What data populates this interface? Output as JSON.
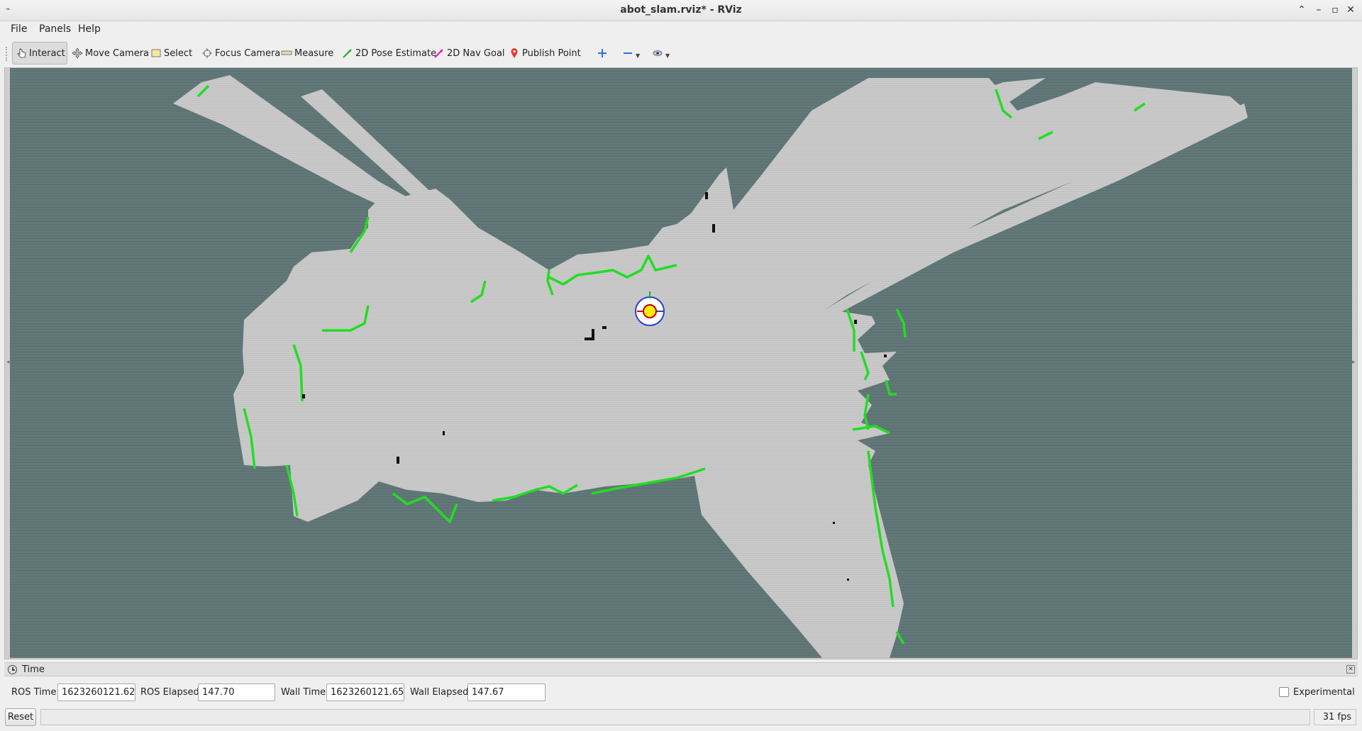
{
  "window": {
    "title": "abot_slam.rviz* - RViz",
    "app_icon": "rviz-icon",
    "controls": [
      "chevron-up-icon",
      "minimize-icon",
      "maximize-icon",
      "close-icon"
    ]
  },
  "menu": {
    "file": "File",
    "panels": "Panels",
    "help": "Help"
  },
  "toolbar": {
    "interact": "Interact",
    "move_camera": "Move Camera",
    "select": "Select",
    "focus_camera": "Focus Camera",
    "measure": "Measure",
    "pose_estimate": "2D Pose Estimate",
    "nav_goal": "2D Nav Goal",
    "publish_point": "Publish Point"
  },
  "viewport": {
    "background": "#627878",
    "free_space": "#c9c9c9",
    "laser_points": "#22dd22",
    "occupied": "#111111"
  },
  "time_panel": {
    "title": "Time",
    "ros_time_label": "ROS Time:",
    "ros_time": "1623260121.62",
    "ros_elapsed_label": "ROS Elapsed:",
    "ros_elapsed": "147.70",
    "wall_time_label": "Wall Time:",
    "wall_time": "1623260121.65",
    "wall_elapsed_label": "Wall Elapsed:",
    "wall_elapsed": "147.67",
    "experimental_label": "Experimental"
  },
  "bottom": {
    "reset": "Reset",
    "fps": "31 fps"
  }
}
